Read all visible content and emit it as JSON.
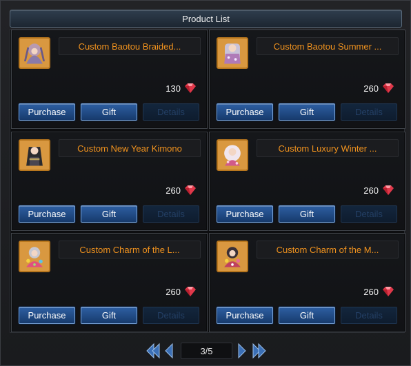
{
  "window": {
    "title": "Product List"
  },
  "currency_icon": "ruby-gem-icon",
  "colors": {
    "product_name": "#f0921e",
    "button": "#2d5fa2",
    "gem": "#e0384a"
  },
  "buttons": {
    "purchase": "Purchase",
    "gift": "Gift",
    "details": "Details"
  },
  "products": [
    {
      "name": "Custom Baotou Braided...",
      "price": "130",
      "icon": "braided-hairstyle-icon"
    },
    {
      "name": "Custom Baotou Summer ...",
      "price": "260",
      "icon": "summer-outfit-icon"
    },
    {
      "name": "Custom New Year Kimono",
      "price": "260",
      "icon": "kimono-icon"
    },
    {
      "name": "Custom Luxury Winter ...",
      "price": "260",
      "icon": "winter-outfit-icon"
    },
    {
      "name": "Custom Charm of the L...",
      "price": "260",
      "icon": "charm-outfit-icon"
    },
    {
      "name": "Custom Charm of the M...",
      "price": "260",
      "icon": "charm-outfit-icon"
    }
  ],
  "pagination": {
    "page_label": "3/5"
  }
}
